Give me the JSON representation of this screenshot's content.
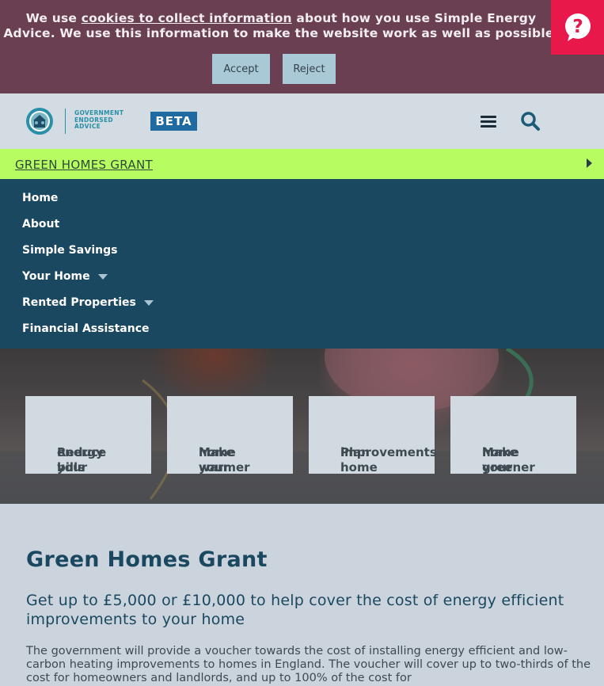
{
  "cookie_banner": {
    "text_before": "We use ",
    "link_text": "cookies to collect information",
    "text_after": " about how you use Simple Energy Advice. We use this information to make the website work as well as possible.",
    "accept_label": "Accept",
    "reject_label": "Reject"
  },
  "header": {
    "logo_text_line1": "GOVERNMENT",
    "logo_text_line2": "ENDORSED",
    "logo_text_line3": "ADVICE",
    "beta_label": "BETA"
  },
  "green_bar": {
    "label": "GREEN HOMES GRANT"
  },
  "nav": {
    "items": [
      {
        "label": "Home"
      },
      {
        "label": "About"
      },
      {
        "label": "Simple Savings"
      },
      {
        "label": "Your Home"
      },
      {
        "label": "Rented Properties"
      },
      {
        "label": "Financial Assistance"
      }
    ]
  },
  "hero": {
    "tiles": [
      {
        "line1": "Reduce your",
        "line2": "energy bills"
      },
      {
        "line1": "Make your",
        "line2": "home warmer"
      },
      {
        "line1": "Plan home",
        "line2": "improvements"
      },
      {
        "line1": "Make your",
        "line2": "home greener"
      }
    ]
  },
  "content": {
    "title": "Green Homes Grant",
    "subtitle": "Get up to £5,000 or £10,000 to help cover the cost of energy efficient improvements to your home",
    "body": "The government will provide a voucher towards the cost of installing energy efficient and low-carbon heating improvements to homes in England. The voucher will cover up to two-thirds of the cost for homeowners and landlords, and up to 100% of the cost for"
  },
  "colors": {
    "cookie_bg": "#6b3f52",
    "help_red": "#e8184b",
    "nav_bg": "#1b4861",
    "green_bar": "#b7fd62",
    "beta_blue": "#1f6aa0"
  },
  "icons": {
    "help": "question-mark-bubble-icon",
    "menu": "hamburger-menu-icon",
    "search": "search-icon",
    "logo": "government-endorsed-logo"
  }
}
